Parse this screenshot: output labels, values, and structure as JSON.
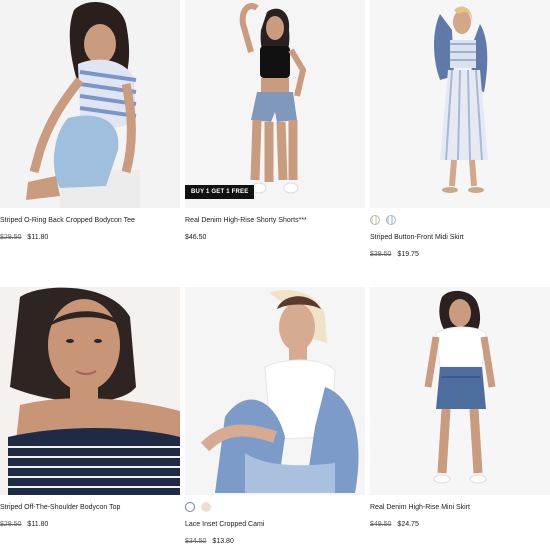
{
  "products": [
    {
      "name": "Striped O-Ring Back Cropped Bodycon Tee",
      "old_price": "$29.50",
      "price": "$11.80"
    },
    {
      "name": "Real Denim High-Rise Shorty Shorts***",
      "price": "$46.50",
      "badge": "BUY 1 GET 1 FREE"
    },
    {
      "name": "Striped Button-Front Midi Skirt",
      "old_price": "$39.50",
      "price": "$19.75",
      "swatches": [
        "#efe2b8",
        "#cfd6e8"
      ]
    },
    {
      "name": "Striped Off-The-Shoulder Bodycon Top",
      "old_price": "$29.50",
      "price": "$11.80"
    },
    {
      "name": "Lace Inset Cropped Cami",
      "old_price": "$34.50",
      "price": "$13.80",
      "swatches": [
        "#ffffff",
        "#f3dcc9"
      ]
    },
    {
      "name": "Real Denim High-Rise Mini Skirt",
      "old_price": "$49.50",
      "price": "$24.75"
    }
  ]
}
